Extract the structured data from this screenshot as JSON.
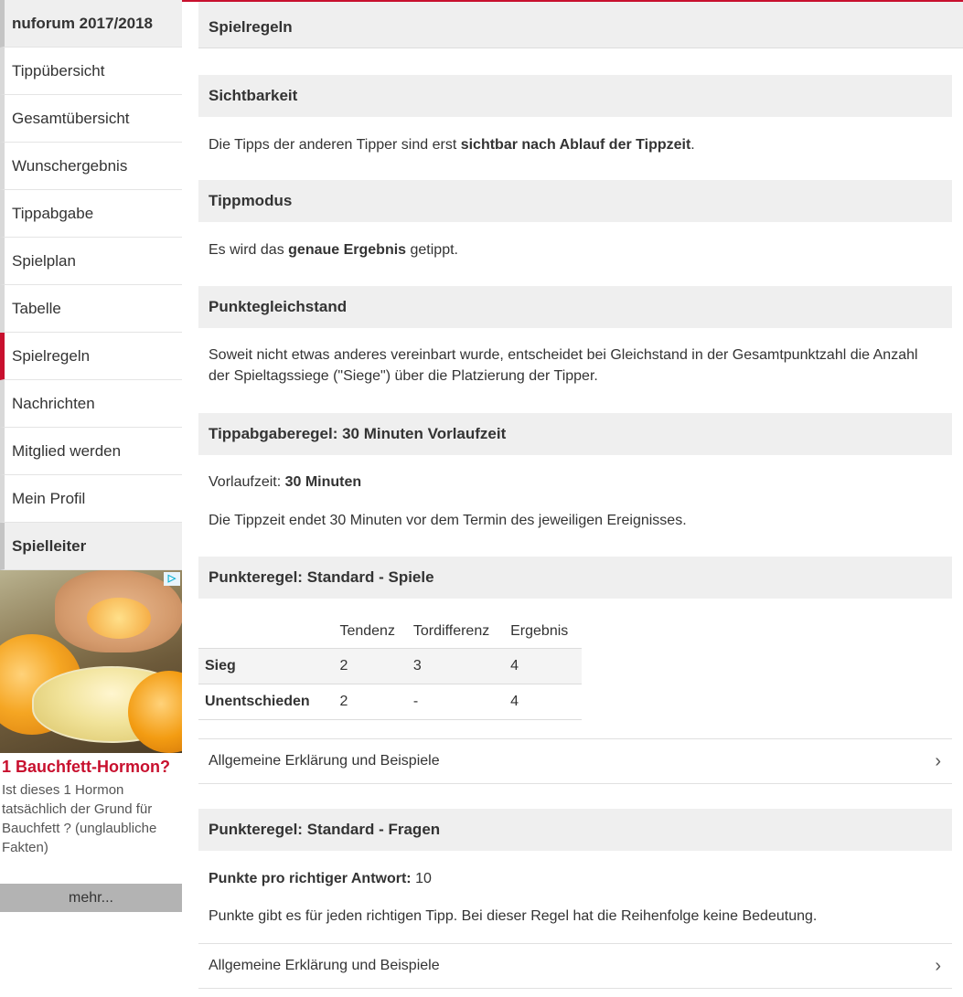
{
  "sidebar": {
    "header": "nuforum 2017/2018",
    "items": [
      {
        "label": "Tippübersicht"
      },
      {
        "label": "Gesamtübersicht"
      },
      {
        "label": "Wunschergebnis"
      },
      {
        "label": "Tippabgabe"
      },
      {
        "label": "Spielplan"
      },
      {
        "label": "Tabelle"
      },
      {
        "label": "Spielregeln"
      },
      {
        "label": "Nachrichten"
      },
      {
        "label": "Mitglied werden"
      },
      {
        "label": "Mein Profil"
      }
    ],
    "footer": "Spielleiter",
    "active_item": "Spielregeln"
  },
  "ad": {
    "badge": "▷",
    "title": "1 Bauchfett-Hormon?",
    "text": "Ist dieses 1 Hormon tatsächlich der Grund für Bauchfett ? (unglaubliche Fakten)",
    "more": "mehr..."
  },
  "main": {
    "title": "Spielregeln",
    "sichtbarkeit": {
      "heading": "Sichtbarkeit",
      "text_pre": "Die Tipps der anderen Tipper sind erst ",
      "text_bold": "sichtbar nach Ablauf der Tippzeit",
      "text_post": "."
    },
    "tippmodus": {
      "heading": "Tippmodus",
      "text_pre": "Es wird das ",
      "text_bold": "genaue Ergebnis",
      "text_post": " getippt."
    },
    "punktegleichstand": {
      "heading": "Punktegleichstand",
      "text": "Soweit nicht etwas anderes vereinbart wurde, entscheidet bei Gleichstand in der Gesamtpunktzahl die Anzahl der Spieltagssiege (\"Siege\") über die Platzierung der Tipper."
    },
    "tippabgaberegel": {
      "heading": "Tippabgaberegel: 30 Minuten Vorlaufzeit",
      "vorlauf_label": "Vorlaufzeit: ",
      "vorlauf_value": "30 Minuten",
      "text": "Die Tippzeit endet 30 Minuten vor dem Termin des jeweiligen Ereignisses."
    },
    "punkteregel_spiele": {
      "heading": "Punkteregel: Standard - Spiele",
      "columns": [
        "",
        "Tendenz",
        "Tordifferenz",
        "Ergebnis"
      ],
      "rows": [
        [
          "Sieg",
          "2",
          "3",
          "4"
        ],
        [
          "Unentschieden",
          "2",
          "-",
          "4"
        ]
      ],
      "explain": "Allgemeine Erklärung und Beispiele"
    },
    "punkteregel_fragen": {
      "heading": "Punkteregel: Standard - Fragen",
      "points_label": "Punkte pro richtiger Antwort:",
      "points_value": " 10",
      "text": "Punkte gibt es für jeden richtigen Tipp. Bei dieser Regel hat die Reihenfolge keine Bedeutung.",
      "explain": "Allgemeine Erklärung und Beispiele"
    }
  },
  "icons": {
    "chevron": "›"
  },
  "colors": {
    "accent": "#c8102e",
    "header_bg": "#efefef",
    "ad_more_bg": "#b3b3b3"
  }
}
